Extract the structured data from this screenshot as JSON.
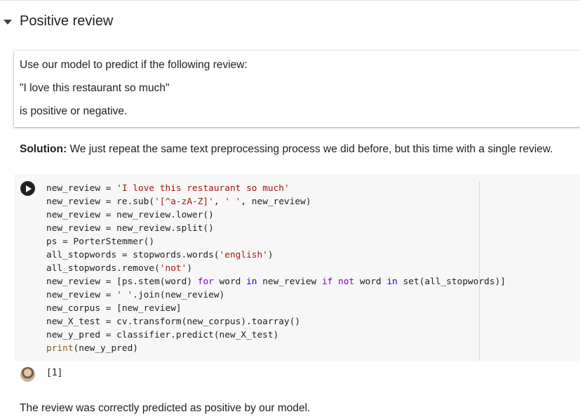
{
  "section": {
    "title": "Positive review"
  },
  "text_cell": {
    "line1": "Use our model to predict if the following review:",
    "line2": "\"I love this restaurant so much\"",
    "line3": "is positive or negative."
  },
  "solution": {
    "label": "Solution:",
    "text": " We just repeat the same text preprocessing process we did before, but this time with a single review."
  },
  "code_cell": {
    "run_icon": "play-icon",
    "lines": [
      "new_review = 'I love this restaurant so much'",
      "new_review = re.sub('[^a-zA-Z]', ' ', new_review)",
      "new_review = new_review.lower()",
      "new_review = new_review.split()",
      "ps = PorterStemmer()",
      "all_stopwords = stopwords.words('english')",
      "all_stopwords.remove('not')",
      "new_review = [ps.stem(word) for word in new_review if not word in set(all_stopwords)]",
      "new_review = ' '.join(new_review)",
      "new_corpus = [new_review]",
      "new_X_test = cv.transform(new_corpus).toarray()",
      "new_y_pred = classifier.predict(new_X_test)",
      "print(new_y_pred)"
    ]
  },
  "output": {
    "text": "[1]",
    "avatar_icon": "user-avatar-icon"
  },
  "conclusion": {
    "text": "The review was correctly predicted as positive by our model."
  }
}
